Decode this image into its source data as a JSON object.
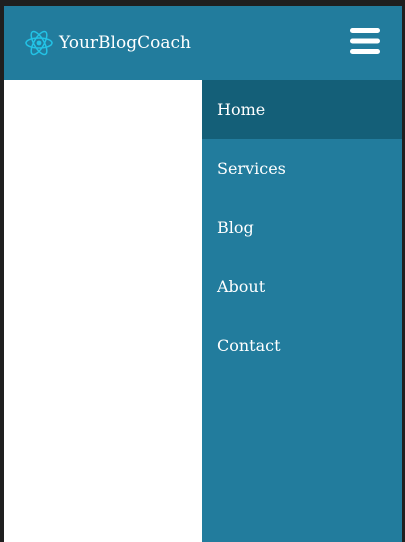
{
  "brand": {
    "name": "YourBlogCoach",
    "logo_icon": "atom-icon"
  },
  "header": {
    "menu_icon": "hamburger-menu-icon"
  },
  "nav": {
    "items": [
      {
        "label": "Home",
        "active": true
      },
      {
        "label": "Services",
        "active": false
      },
      {
        "label": "Blog",
        "active": false
      },
      {
        "label": "About",
        "active": false
      },
      {
        "label": "Contact",
        "active": false
      }
    ]
  },
  "colors": {
    "header_bg": "#227c9d",
    "nav_bg": "#227c9d",
    "nav_active_bg": "#145f78",
    "logo_accent": "#22c3e6",
    "text": "#ffffff"
  }
}
